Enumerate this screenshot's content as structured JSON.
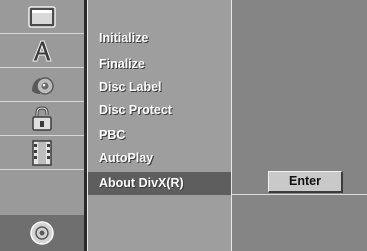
{
  "sidebar": {
    "icons": [
      {
        "name": "tv-screen-icon",
        "selected": false
      },
      {
        "name": "language-letter-icon",
        "selected": false
      },
      {
        "name": "audio-speaker-icon",
        "selected": false
      },
      {
        "name": "lock-icon",
        "selected": false
      },
      {
        "name": "film-record-icon",
        "selected": false
      },
      {
        "name": "disc-icon",
        "selected": true
      }
    ]
  },
  "menu": {
    "items": [
      {
        "label": "Initialize",
        "selected": false
      },
      {
        "label": "Finalize",
        "selected": false
      },
      {
        "label": "Disc Label",
        "selected": false
      },
      {
        "label": "Disc Protect",
        "selected": false
      },
      {
        "label": "PBC",
        "selected": false
      },
      {
        "label": "AutoPlay",
        "selected": false
      },
      {
        "label": "About DivX(R)",
        "selected": true
      }
    ]
  },
  "panel": {
    "enter_label": "Enter"
  },
  "colors": {
    "background": "#8f8f8f",
    "menu_background": "#9e9e9e",
    "selected_row": "#5e5e5e",
    "button": "#c9c9c9",
    "text": "#ffffff"
  }
}
